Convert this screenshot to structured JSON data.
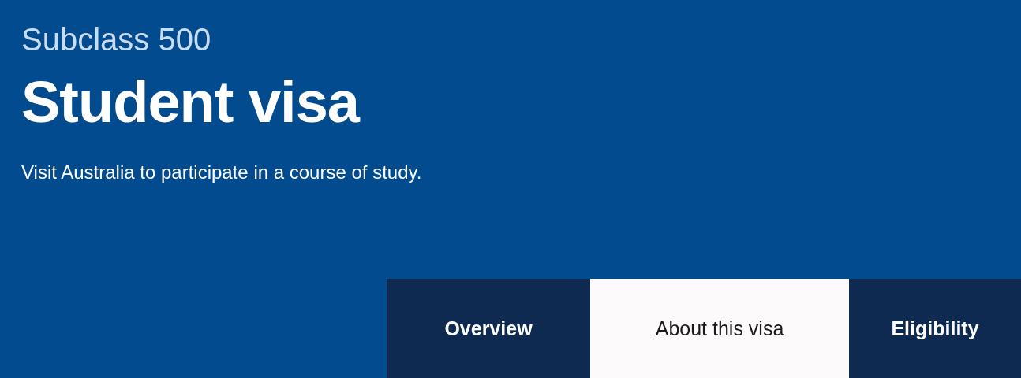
{
  "header": {
    "subtitle": "Subclass 500",
    "title": "Student visa",
    "description": "Visit Australia to participate in a course of study."
  },
  "tabs": [
    {
      "label": "Overview",
      "selected": false
    },
    {
      "label": "About this visa",
      "selected": true
    },
    {
      "label": "Eligibility",
      "selected": false
    }
  ]
}
